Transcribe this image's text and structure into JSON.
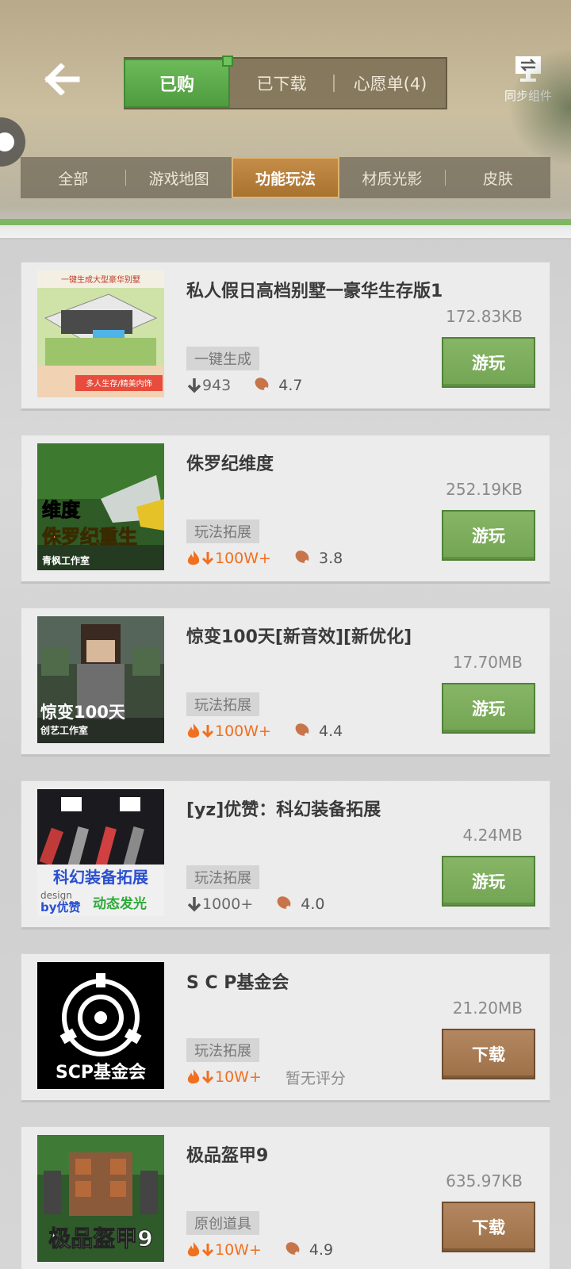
{
  "header": {
    "tabs": [
      {
        "label": "已购",
        "active": true
      },
      {
        "label": "已下载",
        "active": false
      },
      {
        "label": "心愿单(4)",
        "active": false
      }
    ],
    "sync_label": "同步组件",
    "categories": [
      {
        "label": "全部",
        "active": false
      },
      {
        "label": "游戏地图",
        "active": false
      },
      {
        "label": "功能玩法",
        "active": true
      },
      {
        "label": "材质光影",
        "active": false
      },
      {
        "label": "皮肤",
        "active": false
      }
    ]
  },
  "items": [
    {
      "title": "私人假日高档别墅一豪华生存版1",
      "size": "172.83KB",
      "tag": "一键生成",
      "hot": false,
      "downloads": "943",
      "rating": "4.7",
      "action": "游玩",
      "thumb_text": [
        "一键生成大型豪华别墅",
        "多人生存/精美内饰"
      ]
    },
    {
      "title": "侏罗纪维度",
      "size": "252.19KB",
      "tag": "玩法拓展",
      "hot": true,
      "downloads": "100W+",
      "rating": "3.8",
      "action": "游玩",
      "thumb_text": [
        "维度",
        "侏罗纪重生",
        "青枫工作室"
      ]
    },
    {
      "title": "惊变100天[新音效][新优化]",
      "size": "17.70MB",
      "tag": "玩法拓展",
      "hot": true,
      "downloads": "100W+",
      "rating": "4.4",
      "action": "游玩",
      "thumb_text": [
        "惊变100天",
        "创艺工作室"
      ]
    },
    {
      "title": "[yz]优赞：科幻装备拓展",
      "size": "4.24MB",
      "tag": "玩法拓展",
      "hot": false,
      "downloads": "1000+",
      "rating": "4.0",
      "action": "游玩",
      "thumb_text": [
        "科幻装备拓展",
        "design",
        "by优赞",
        "动态发光"
      ]
    },
    {
      "title": "S C P基金会",
      "size": "21.20MB",
      "tag": "玩法拓展",
      "hot": true,
      "downloads": "10W+",
      "rating": "暂无评分",
      "action": "下载",
      "thumb_text": [
        "SCP基金会"
      ]
    },
    {
      "title": "极品盔甲9",
      "size": "635.97KB",
      "tag": "原创道具",
      "hot": true,
      "downloads": "10W+",
      "rating": "4.9",
      "action": "下载",
      "thumb_text": [
        "极品盔甲9"
      ]
    }
  ],
  "icons": {
    "back": "back-arrow-icon",
    "sync": "sync-icon",
    "download": "download-arrow-icon",
    "hot": "flame-icon",
    "rating": "drumstick-icon"
  },
  "colors": {
    "active_tab": "#5aaa48",
    "active_category": "#b57d3b",
    "play_button": "#7aab5a",
    "download_button": "#a67a52",
    "hot_text": "#f07020"
  }
}
